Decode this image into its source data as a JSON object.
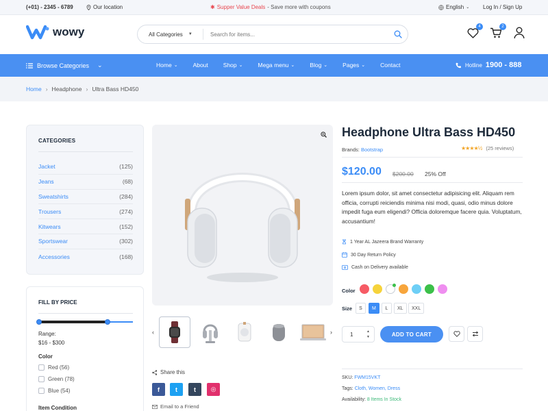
{
  "topbar": {
    "phone": "(+01) - 2345 - 6789",
    "location": "Our location",
    "deal_highlight": "Supper Value Deals",
    "deal_text": "- Save more with coupons",
    "language": "English",
    "login": "Log In / Sign Up"
  },
  "header": {
    "logo_text": "wowy",
    "search_category": "All Categories",
    "search_placeholder": "Search for items...",
    "wishlist_count": "4",
    "cart_count": "2"
  },
  "nav": {
    "browse": "Browse Categories",
    "items": [
      {
        "label": "Home",
        "dropdown": true
      },
      {
        "label": "About",
        "dropdown": false
      },
      {
        "label": "Shop",
        "dropdown": true
      },
      {
        "label": "Mega menu",
        "dropdown": true
      },
      {
        "label": "Blog",
        "dropdown": true
      },
      {
        "label": "Pages",
        "dropdown": true
      },
      {
        "label": "Contact",
        "dropdown": false
      }
    ],
    "hotline_label": "Hotline",
    "hotline_number": "1900 - 888"
  },
  "breadcrumb": {
    "home": "Home",
    "category": "Headphone",
    "current": "Ultra Bass HD450",
    "separator": "›"
  },
  "sidebar": {
    "categories_title": "CATEGORIES",
    "categories": [
      {
        "name": "Jacket",
        "count": "(125)"
      },
      {
        "name": "Jeans",
        "count": "(68)"
      },
      {
        "name": "Sweatshirts",
        "count": "(284)"
      },
      {
        "name": "Trousers",
        "count": "(274)"
      },
      {
        "name": "Kitwears",
        "count": "(152)"
      },
      {
        "name": "Sportswear",
        "count": "(302)"
      },
      {
        "name": "Accessories",
        "count": "(168)"
      }
    ],
    "price_title": "FILL BY PRICE",
    "range_label": "Range:",
    "range_value": "$16 - $300",
    "range_fraction": [
      0.0,
      0.73
    ],
    "color_title": "Color",
    "color_filters": [
      {
        "label": "Red (56)"
      },
      {
        "label": "Green (78)"
      },
      {
        "label": "Blue (54)"
      }
    ],
    "condition_title": "Item Condition"
  },
  "gallery": {
    "share_label": "Share this",
    "email_label": "Email to a Friend",
    "social": [
      {
        "icon": "facebook-icon",
        "glyph": "f",
        "color": "#3b5998"
      },
      {
        "icon": "twitter-icon",
        "glyph": "t",
        "color": "#1da1f2"
      },
      {
        "icon": "tumblr-icon",
        "glyph": "t",
        "color": "#34465d"
      },
      {
        "icon": "instagram-icon",
        "glyph": "◎",
        "color": "#e1306c"
      }
    ]
  },
  "product": {
    "title": "Headphone Ultra Bass HD450",
    "brands_label": "Brands:",
    "brand": "Bootstrap",
    "rating": 4.5,
    "stars": "★★★★½",
    "reviews": "(25 reviews)",
    "price": "$120.00",
    "old_price": "$200.00",
    "discount": "25% Off",
    "description": "Lorem ipsum dolor, sit amet consectetur adipisicing elit. Aliquam rem officia, corrupti reiciendis minima nisi modi, quasi, odio minus dolore impedit fuga eum eligendi? Officia doloremque facere quia. Voluptatum, accusantium!",
    "features": [
      {
        "icon": "warranty-icon",
        "text": "1 Year AL Jazeera Brand Warranty"
      },
      {
        "icon": "return-icon",
        "text": "30 Day Return Policy"
      },
      {
        "icon": "cash-icon",
        "text": "Cash on Delivery available"
      }
    ],
    "color_label": "Color",
    "colors": [
      {
        "hex": "#f65b65",
        "active": false
      },
      {
        "hex": "#f6d33b",
        "active": false
      },
      {
        "hex": "#ffffff",
        "active": true
      },
      {
        "hex": "#f7a53c",
        "active": false
      },
      {
        "hex": "#6ecff6",
        "active": false
      },
      {
        "hex": "#3cc04a",
        "active": false
      },
      {
        "hex": "#ef8ef0",
        "active": false
      }
    ],
    "size_label": "Size",
    "sizes": [
      {
        "label": "S",
        "active": false
      },
      {
        "label": "M",
        "active": true
      },
      {
        "label": "L",
        "active": false
      },
      {
        "label": "XL",
        "active": false
      },
      {
        "label": "XXL",
        "active": false
      }
    ],
    "quantity": "1",
    "add_to_cart": "ADD TO CART",
    "sku_label": "SKU:",
    "sku": "FWM15VKT",
    "tags_label": "Tags:",
    "tags": "Cloth, Women, Dress",
    "availability_label": "Availability:",
    "availability": "8 Items In Stock"
  },
  "colors": {
    "accent": "#4a90f2",
    "link": "#3b8cf6",
    "stock": "#3cb878"
  }
}
